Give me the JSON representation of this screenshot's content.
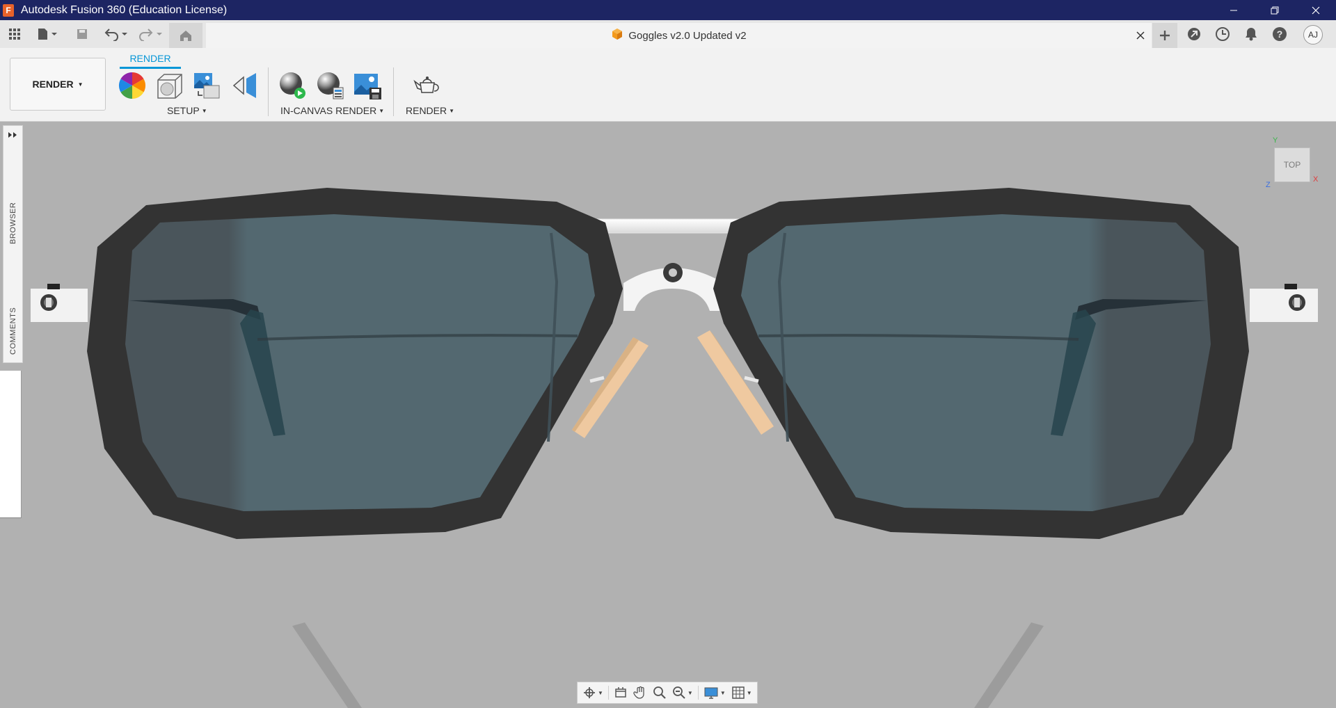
{
  "window": {
    "title": "Autodesk Fusion 360 (Education License)",
    "logo_letter": "F",
    "controls": [
      "minimize-icon",
      "restore-icon",
      "close-icon"
    ]
  },
  "quick_access": {
    "icons": [
      "grid-menu-icon",
      "file-icon",
      "save-icon",
      "undo-icon",
      "redo-icon",
      "home-icon"
    ]
  },
  "document_tab": {
    "title": "Goggles v2.0 Updated v2",
    "icon": "component-cube-icon",
    "close_icon": "close-icon"
  },
  "header_right": {
    "icons": [
      "new-tab-plus-icon",
      "extensions-icon",
      "job-status-clock-icon",
      "notifications-bell-icon",
      "help-icon"
    ],
    "user_initials": "AJ"
  },
  "toolbar": {
    "workspace": "RENDER",
    "active_tab": "RENDER",
    "groups": [
      {
        "label": "SETUP",
        "tools": [
          "appearance-icon",
          "scene-settings-icon",
          "texture-map-icon",
          "decal-icon"
        ]
      },
      {
        "label": "IN-CANVAS RENDER",
        "tools": [
          "in-canvas-render-icon",
          "in-canvas-render-settings-icon",
          "capture-image-icon"
        ]
      },
      {
        "label": "RENDER",
        "tools": [
          "render-teapot-icon"
        ]
      }
    ]
  },
  "side_panel": {
    "labels": [
      "BROWSER",
      "COMMENTS"
    ],
    "expand_icon": "expand-arrows-icon"
  },
  "viewcube": {
    "face": "TOP",
    "axes": {
      "y": "Y",
      "x": "X",
      "z": "Z"
    },
    "axis_colors": {
      "x": "#e03b3b",
      "y": "#3ab54a",
      "z": "#3b6fe0"
    }
  },
  "nav_toolbar": {
    "items": [
      "orbit-icon",
      "look-at-icon",
      "pan-icon",
      "zoom-icon",
      "fit-zoom-icon",
      "display-settings-icon",
      "grid-settings-icon"
    ]
  },
  "colors": {
    "title_bar": "#1d2563",
    "accent": "#0696d7",
    "frame": "#333333",
    "lens": "#4f6168",
    "canvas_bg": "#b1b1b1",
    "nose_pad": "#efc9a0"
  }
}
